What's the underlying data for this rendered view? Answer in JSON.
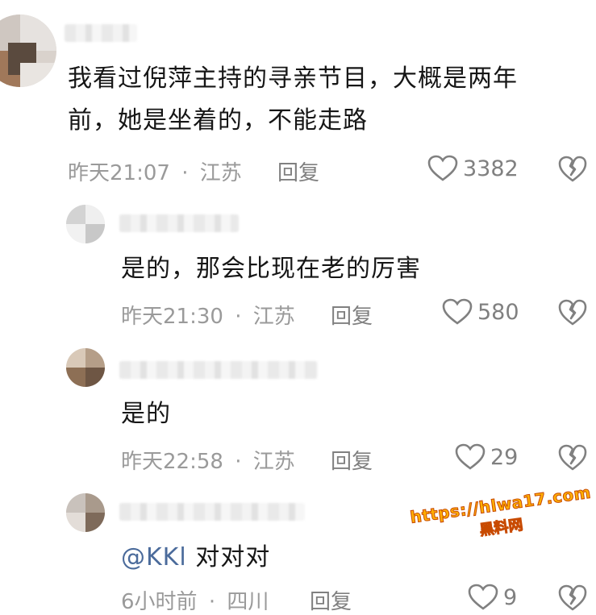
{
  "comments": [
    {
      "text_line1": "我看过倪萍主持的寻亲节目，大概是两年",
      "text_line2": "前，她是坐着的，不能走路",
      "time": "昨天21:07",
      "location": "江苏",
      "reply_label": "回复",
      "likes": "3382"
    },
    {
      "text": "是的，那会比现在老的厉害",
      "time": "昨天21:30",
      "location": "江苏",
      "reply_label": "回复",
      "likes": "580"
    },
    {
      "text": "是的",
      "time": "昨天22:58",
      "location": "江苏",
      "reply_label": "回复",
      "likes": "29"
    },
    {
      "mention": "@KKl",
      "text": " 对对对",
      "time": "6小时前",
      "location": "四川",
      "reply_label": "回复",
      "likes": "9"
    }
  ],
  "separator": "·",
  "watermark": {
    "url": "https://hlwa17.com",
    "name": "黑料网"
  },
  "colors": {
    "text": "#161616",
    "meta": "#9a9a9a",
    "mention": "#4b6b9b",
    "watermark_fill": "#ffb000",
    "watermark_stroke": "#c84a00"
  }
}
